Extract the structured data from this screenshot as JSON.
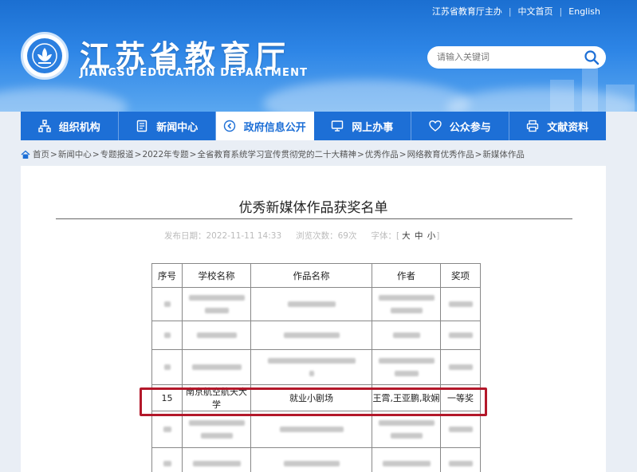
{
  "header": {
    "top_links": [
      "江苏省教育厅主办",
      "中文首页",
      "English"
    ],
    "title": "江苏省教育厅",
    "subtitle": "JIANGSU EDUCATION DEPARTMENT",
    "search_placeholder": "请输入关键词"
  },
  "nav": [
    {
      "label": "组织机构",
      "icon": "org-chart-icon"
    },
    {
      "label": "新闻中心",
      "icon": "document-icon"
    },
    {
      "label": "政府信息公开",
      "icon": "info-disclosure-icon",
      "active": true
    },
    {
      "label": "网上办事",
      "icon": "monitor-icon"
    },
    {
      "label": "公众参与",
      "icon": "heart-icon"
    },
    {
      "label": "文献资料",
      "icon": "printer-icon"
    }
  ],
  "breadcrumb": [
    "首页",
    "新闻中心",
    "专题报道",
    "2022年专题",
    "全省教育系统学习宣传贯彻党的二十大精神",
    "优秀作品",
    "网络教育优秀作品",
    "新媒体作品"
  ],
  "article": {
    "title": "优秀新媒体作品获奖名单",
    "date_label": "发布日期：",
    "date": "2022-11-11 14:33",
    "views_label": "浏览次数：",
    "views": "69次",
    "font_label": "字体：[",
    "font_sizes": [
      "大",
      "中",
      "小"
    ],
    "font_close": "]"
  },
  "table": {
    "headers": [
      "序号",
      "学校名称",
      "作品名称",
      "作者",
      "奖项"
    ],
    "highlight_row": {
      "no": "15",
      "school": "南京航空航天大学",
      "work": "就业小剧场",
      "authors": "王霄,王亚鹏,耿娴",
      "award": "一等奖"
    }
  },
  "colors": {
    "brand_blue": "#1d6fd6",
    "highlight_border": "#b3182a"
  }
}
